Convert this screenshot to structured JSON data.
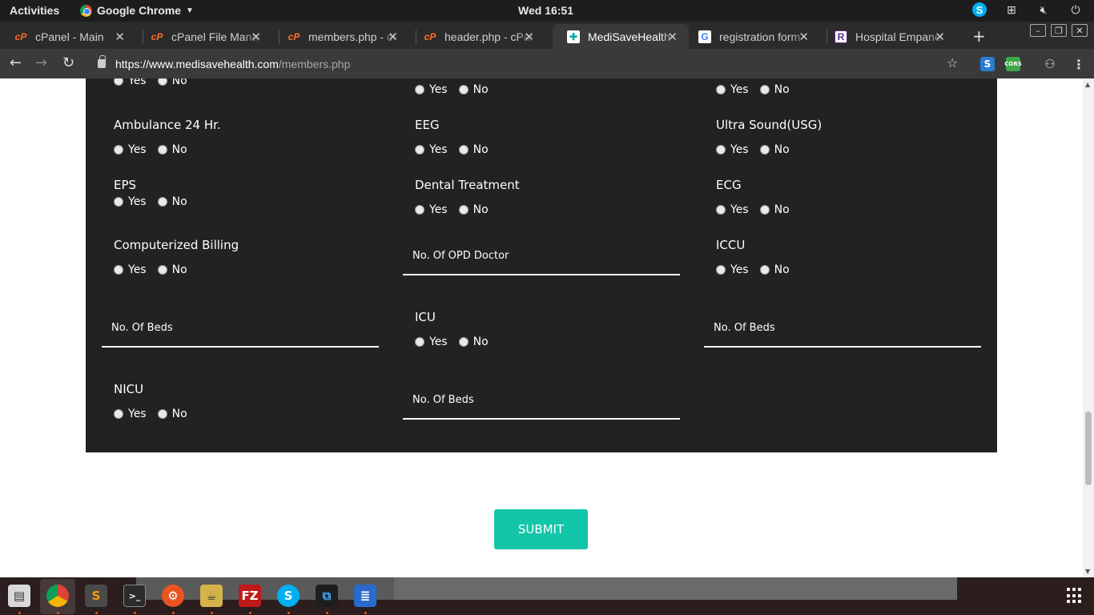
{
  "system": {
    "activities": "Activities",
    "app_name": "Google Chrome",
    "clock": "Wed 16:51"
  },
  "tabs": [
    {
      "label": "cPanel - Main",
      "icon": "cpanel-icon"
    },
    {
      "label": "cPanel File Manager",
      "icon": "cpanel-icon"
    },
    {
      "label": "members.php - cPanel",
      "icon": "cpanel-icon"
    },
    {
      "label": "header.php - cPanel",
      "icon": "cpanel-icon"
    },
    {
      "label": "MediSaveHealth",
      "icon": "medisave-icon",
      "active": true
    },
    {
      "label": "registration form",
      "icon": "google-icon"
    },
    {
      "label": "Hospital Empanelment",
      "icon": "r-icon"
    }
  ],
  "address": {
    "host": "https://www.medisavehealth.com",
    "path": "/members.php"
  },
  "form": {
    "yes": "Yes",
    "no": "No",
    "fields": {
      "ambulance": "Ambulance 24 Hr.",
      "eeg": "EEG",
      "usg": "Ultra Sound(USG)",
      "eps": "EPS",
      "dental": "Dental Treatment",
      "ecg": "ECG",
      "billing": "Computerized Billing",
      "opd_doctor": "No. Of OPD Doctor",
      "iccu": "ICCU",
      "beds_1": "No. Of Beds",
      "icu": "ICU",
      "beds_2": "No. Of Beds",
      "nicu": "NICU",
      "beds_3": "No. Of Beds"
    },
    "submit_label": "SUBMIT"
  },
  "colors": {
    "panel_bg": "#222222",
    "submit_bg": "#13c6a8"
  }
}
